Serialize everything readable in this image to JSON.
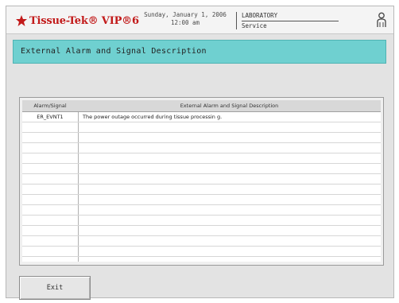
{
  "header": {
    "brand": "Tissue-Tek® VIP®6",
    "date": "Sunday, January 1, 2006",
    "time": "12:00 am",
    "department": "LABORATORY",
    "role": "Service"
  },
  "screen": {
    "title": "External Alarm and Signal Description"
  },
  "table": {
    "columns": [
      "Alarm/Signal",
      "External Alarm and Signal Description"
    ],
    "rows": [
      {
        "signal": "ER_EVNT1",
        "description": "The power outage occurred during tissue processin g."
      },
      {
        "signal": "",
        "description": ""
      },
      {
        "signal": "",
        "description": ""
      },
      {
        "signal": "",
        "description": ""
      },
      {
        "signal": "",
        "description": ""
      },
      {
        "signal": "",
        "description": ""
      },
      {
        "signal": "",
        "description": ""
      },
      {
        "signal": "",
        "description": ""
      },
      {
        "signal": "",
        "description": ""
      },
      {
        "signal": "",
        "description": ""
      },
      {
        "signal": "",
        "description": ""
      },
      {
        "signal": "",
        "description": ""
      },
      {
        "signal": "",
        "description": ""
      },
      {
        "signal": "",
        "description": ""
      }
    ]
  },
  "footer": {
    "exit_label": "Exit"
  },
  "colors": {
    "title_bar": "#6fd0d0",
    "brand_red": "#c21a1a",
    "background": "#e3e3e3"
  },
  "icons": {
    "logo": "star-logo-icon",
    "user": "user-icon"
  }
}
